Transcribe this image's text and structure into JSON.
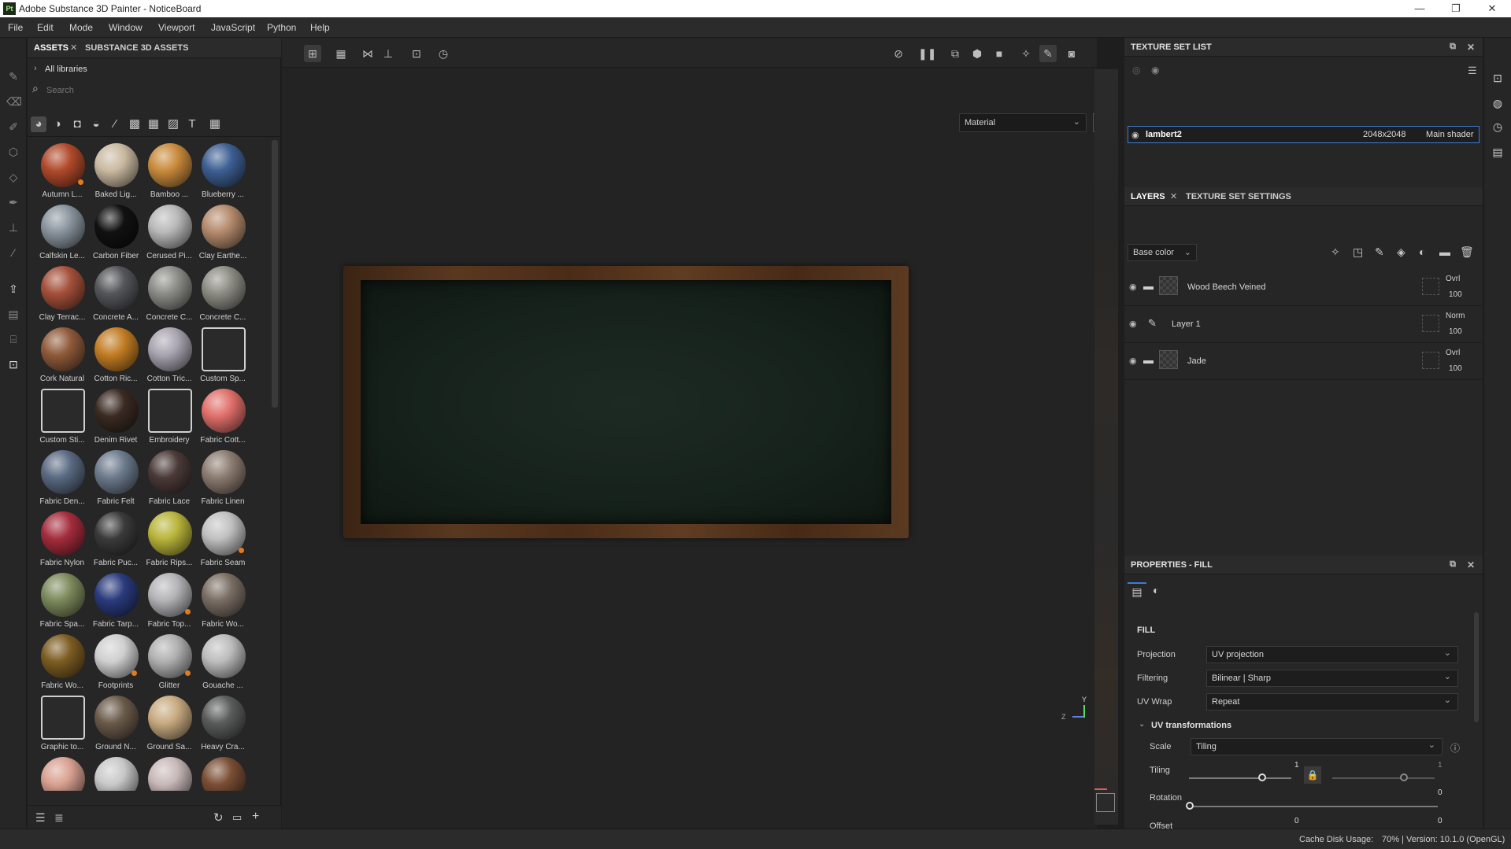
{
  "window": {
    "title": "Adobe Substance 3D Painter - NoticeBoard",
    "logo": "Pt"
  },
  "menu": [
    "File",
    "Edit",
    "Mode",
    "Window",
    "Viewport",
    "JavaScript",
    "Python",
    "Help"
  ],
  "assets": {
    "tabs": [
      "ASSETS",
      "SUBSTANCE 3D ASSETS"
    ],
    "breadcrumb": "All libraries",
    "search_placeholder": "Search",
    "items": [
      {
        "label": "Autumn L...",
        "color": "#b04a2a",
        "badge": true
      },
      {
        "label": "Baked Lig...",
        "color": "#c9b9a0"
      },
      {
        "label": "Bamboo ...",
        "color": "#c98a3c"
      },
      {
        "label": "Blueberry ...",
        "color": "#3d5f92"
      },
      {
        "label": "Calfskin Le...",
        "color": "#8a949e"
      },
      {
        "label": "Carbon Fiber",
        "color": "#111111"
      },
      {
        "label": "Cerused Pi...",
        "color": "#b8b8b8"
      },
      {
        "label": "Clay Earthe...",
        "color": "#b48a6c"
      },
      {
        "label": "Clay Terrac...",
        "color": "#a4503a"
      },
      {
        "label": "Concrete A...",
        "color": "#55565a"
      },
      {
        "label": "Concrete C...",
        "color": "#8c8c88"
      },
      {
        "label": "Concrete C...",
        "color": "#8d8c84"
      },
      {
        "label": "Cork Natural",
        "color": "#8f5a3a"
      },
      {
        "label": "Cotton Ric...",
        "color": "#c27c24"
      },
      {
        "label": "Cotton Tric...",
        "color": "#a8a4b0"
      },
      {
        "label": "Custom Sp...",
        "color": "tile"
      },
      {
        "label": "Custom Sti...",
        "color": "tile"
      },
      {
        "label": "Denim Rivet",
        "color": "#3a2a22"
      },
      {
        "label": "Embroidery",
        "color": "tile"
      },
      {
        "label": "Fabric Cott...",
        "color": "#e06f6a"
      },
      {
        "label": "Fabric Den...",
        "color": "#5a6a82"
      },
      {
        "label": "Fabric Felt",
        "color": "#6c7a8c"
      },
      {
        "label": "Fabric Lace",
        "color": "#4a3a38"
      },
      {
        "label": "Fabric Linen",
        "color": "#8c7c70"
      },
      {
        "label": "Fabric Nylon",
        "color": "#a42c3c"
      },
      {
        "label": "Fabric Puc...",
        "color": "#3a3a3a"
      },
      {
        "label": "Fabric Rips...",
        "color": "#b8b43a"
      },
      {
        "label": "Fabric Seam",
        "color": "#c0c0c0",
        "badge": true
      },
      {
        "label": "Fabric Spa...",
        "color": "#7c8a5c"
      },
      {
        "label": "Fabric Tarp...",
        "color": "#2a3a7c"
      },
      {
        "label": "Fabric Top...",
        "color": "#b4b4b8",
        "badge": true
      },
      {
        "label": "Fabric Wo...",
        "color": "#7a6e64"
      },
      {
        "label": "Fabric Wo...",
        "color": "#7c5c22"
      },
      {
        "label": "Footprints",
        "color": "#cfcfcf",
        "badge": true
      },
      {
        "label": "Glitter",
        "color": "#b0b0b0",
        "badge": true
      },
      {
        "label": "Gouache ...",
        "color": "#bcbcbc"
      },
      {
        "label": "Graphic to...",
        "color": "tile"
      },
      {
        "label": "Ground N...",
        "color": "#6a5a4a"
      },
      {
        "label": "Ground Sa...",
        "color": "#c8aa80"
      },
      {
        "label": "Heavy Cra...",
        "color": "#5a5c5c"
      },
      {
        "label": "",
        "color": "#d8a090"
      },
      {
        "label": "",
        "color": "#c8c8c8",
        "badge": true
      },
      {
        "label": "",
        "color": "#c8b8b8"
      },
      {
        "label": "",
        "color": "#7a4e34"
      }
    ]
  },
  "viewport": {
    "material_mode": "Material"
  },
  "texture_set_list": {
    "title": "TEXTURE SET LIST",
    "row": {
      "name": "lambert2",
      "size": "2048x2048",
      "shader": "Main shader"
    }
  },
  "layers": {
    "tabs": [
      "LAYERS",
      "TEXTURE SET SETTINGS"
    ],
    "channel": "Base color",
    "items": [
      {
        "name": "Wood Beech Veined",
        "type": "folder",
        "blend": "Ovrl",
        "opacity": "100"
      },
      {
        "name": "Layer 1",
        "type": "paint",
        "blend": "Norm",
        "opacity": "100"
      },
      {
        "name": "Jade",
        "type": "folder",
        "blend": "Ovrl",
        "opacity": "100"
      }
    ]
  },
  "properties": {
    "title": "PROPERTIES - FILL",
    "section": "FILL",
    "projection": {
      "label": "Projection",
      "value": "UV projection"
    },
    "filtering": {
      "label": "Filtering",
      "value": "Bilinear | Sharp"
    },
    "uvwrap": {
      "label": "UV Wrap",
      "value": "Repeat"
    },
    "uvtrans": "UV transformations",
    "scale": {
      "label": "Scale",
      "value": "Tiling"
    },
    "tiling": {
      "label": "Tiling",
      "value1": "1",
      "value2": "1"
    },
    "rotation": {
      "label": "Rotation",
      "value": "0"
    },
    "offset": {
      "label": "Offset",
      "value1": "0",
      "value2": "0"
    }
  },
  "status": {
    "cache": "Cache Disk Usage:",
    "info": "70% | Version: 10.1.0 (OpenGL)"
  },
  "axis": {
    "y": "Y",
    "z": "Z"
  }
}
